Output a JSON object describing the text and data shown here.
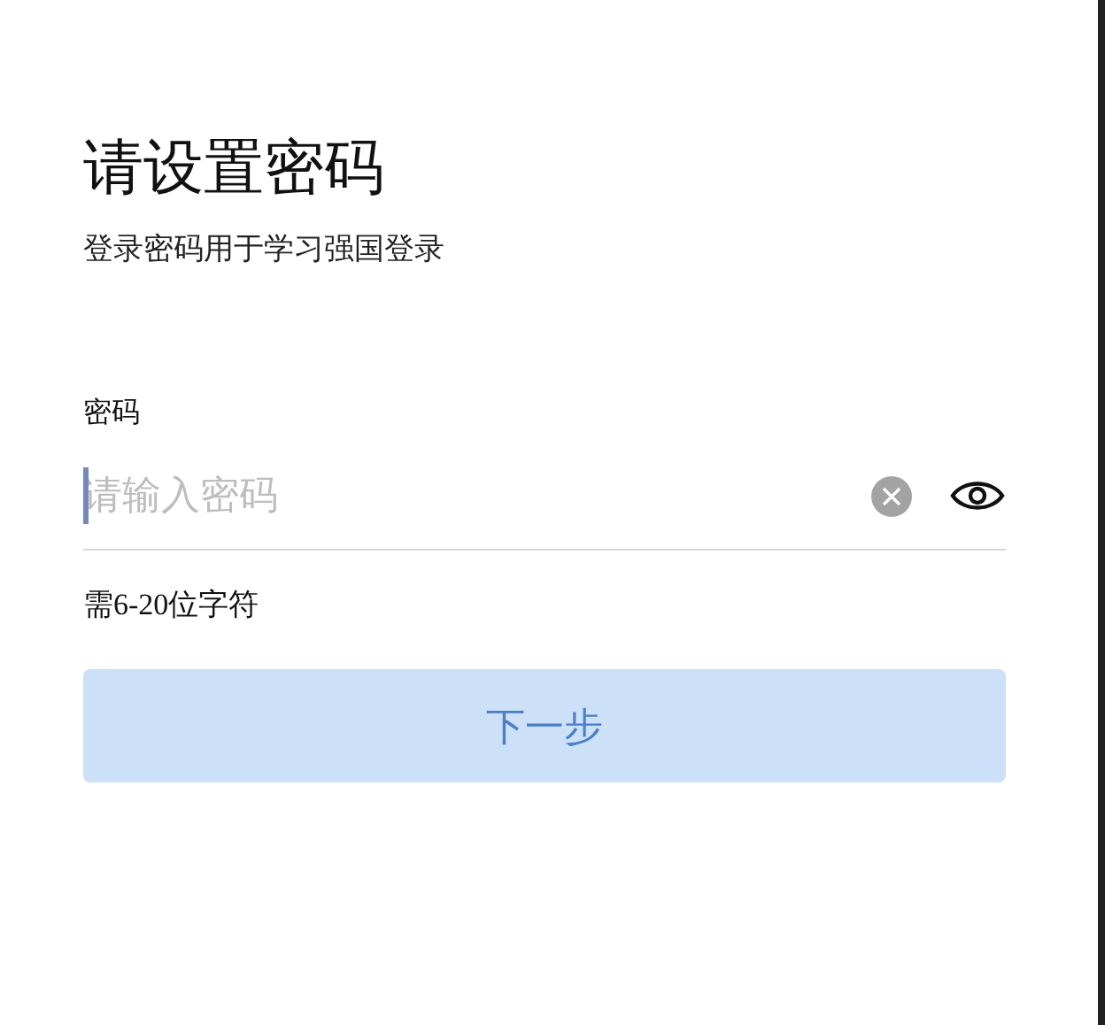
{
  "title": "请设置密码",
  "subtitle": "登录密码用于学习强国登录",
  "password_field": {
    "label": "密码",
    "placeholder": "请输入密码",
    "focused": true
  },
  "hint": "需6-20位字符",
  "next_button": {
    "label": "下一步",
    "disabled": true
  }
}
